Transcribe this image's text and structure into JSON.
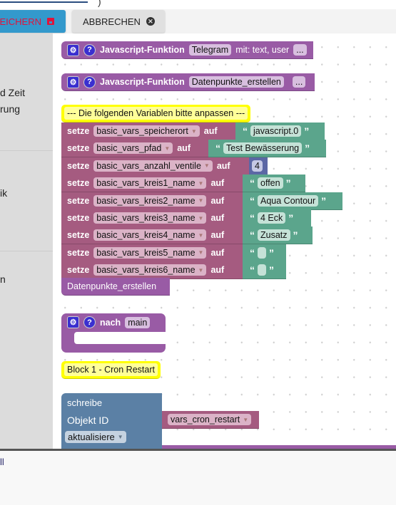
{
  "top": {
    "paren": ")"
  },
  "toolbar": {
    "save_label": "EICHERN",
    "cancel_label": "ABBRECHEN",
    "save_icon": "floppy-icon",
    "cancel_icon": "close-circle-icon"
  },
  "sidebar": {
    "items": [
      "d Zeit",
      "rung",
      "ik",
      "n"
    ]
  },
  "blocks": {
    "fn1": {
      "label": "Javascript-Funktion",
      "name": "Telegram",
      "params": "mit: text, user",
      "more": "..."
    },
    "fn2": {
      "label": "Javascript-Funktion",
      "name": "Datenpunkte_erstellen",
      "more": "..."
    },
    "comment1": "--- Die folgenden Variablen bitte anpassen ---",
    "set_label": "setze",
    "to_label": "auf",
    "sets": [
      {
        "var": "basic_vars_speicherort",
        "value": "javascript.0",
        "kind": "text"
      },
      {
        "var": "basic_vars_pfad",
        "value": "Test Bewässerung",
        "kind": "text"
      },
      {
        "var": "basic_vars_anzahl_ventile",
        "value": "4",
        "kind": "number"
      },
      {
        "var": "basic_vars_kreis1_name",
        "value": "offen",
        "kind": "text"
      },
      {
        "var": "basic_vars_kreis2_name",
        "value": "Aqua Contour",
        "kind": "text"
      },
      {
        "var": "basic_vars_kreis3_name",
        "value": "4 Eck",
        "kind": "text"
      },
      {
        "var": "basic_vars_kreis4_name",
        "value": "Zusatz",
        "kind": "text"
      },
      {
        "var": "basic_vars_kreis5_name",
        "value": "",
        "kind": "text"
      },
      {
        "var": "basic_vars_kreis6_name",
        "value": "",
        "kind": "text"
      }
    ],
    "call": "Datenpunkte_erstellen",
    "after": {
      "label": "nach",
      "name": "main"
    },
    "comment2": "Block 1 - Cron Restart",
    "write": {
      "label": "schreibe",
      "id_label": "Objekt ID",
      "mode": "aktualisiere",
      "var": "vars_cron_restart"
    }
  },
  "bottom": {
    "text": "ll"
  },
  "colors": {
    "function": "#995ba5",
    "variable": "#a55b80",
    "text": "#5ba58c",
    "number": "#5b67a5",
    "object": "#5b80a5",
    "comment": "#ffff00",
    "save": "#3399cc"
  }
}
